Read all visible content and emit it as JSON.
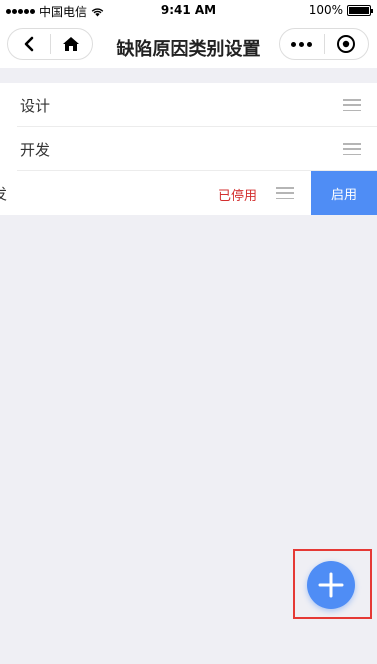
{
  "status_bar": {
    "carrier": "中国电信",
    "time": "9:41 AM",
    "battery_text": "100%"
  },
  "nav": {
    "title": "缺陷原因类别设置",
    "icons": [
      "back-icon",
      "home-icon",
      "more-icon",
      "close-circle-icon"
    ]
  },
  "categories": {
    "items": [
      {
        "label": "设计"
      },
      {
        "label": "开发"
      }
    ],
    "swiped_item": {
      "label": "发",
      "status": "已停用",
      "action_label": "启用"
    }
  },
  "colors": {
    "accent": "#4f8df5",
    "status_disabled": "#d32f2f",
    "highlight": "#e53935",
    "background": "#efeff4"
  },
  "fab": {
    "icon": "plus-icon"
  }
}
